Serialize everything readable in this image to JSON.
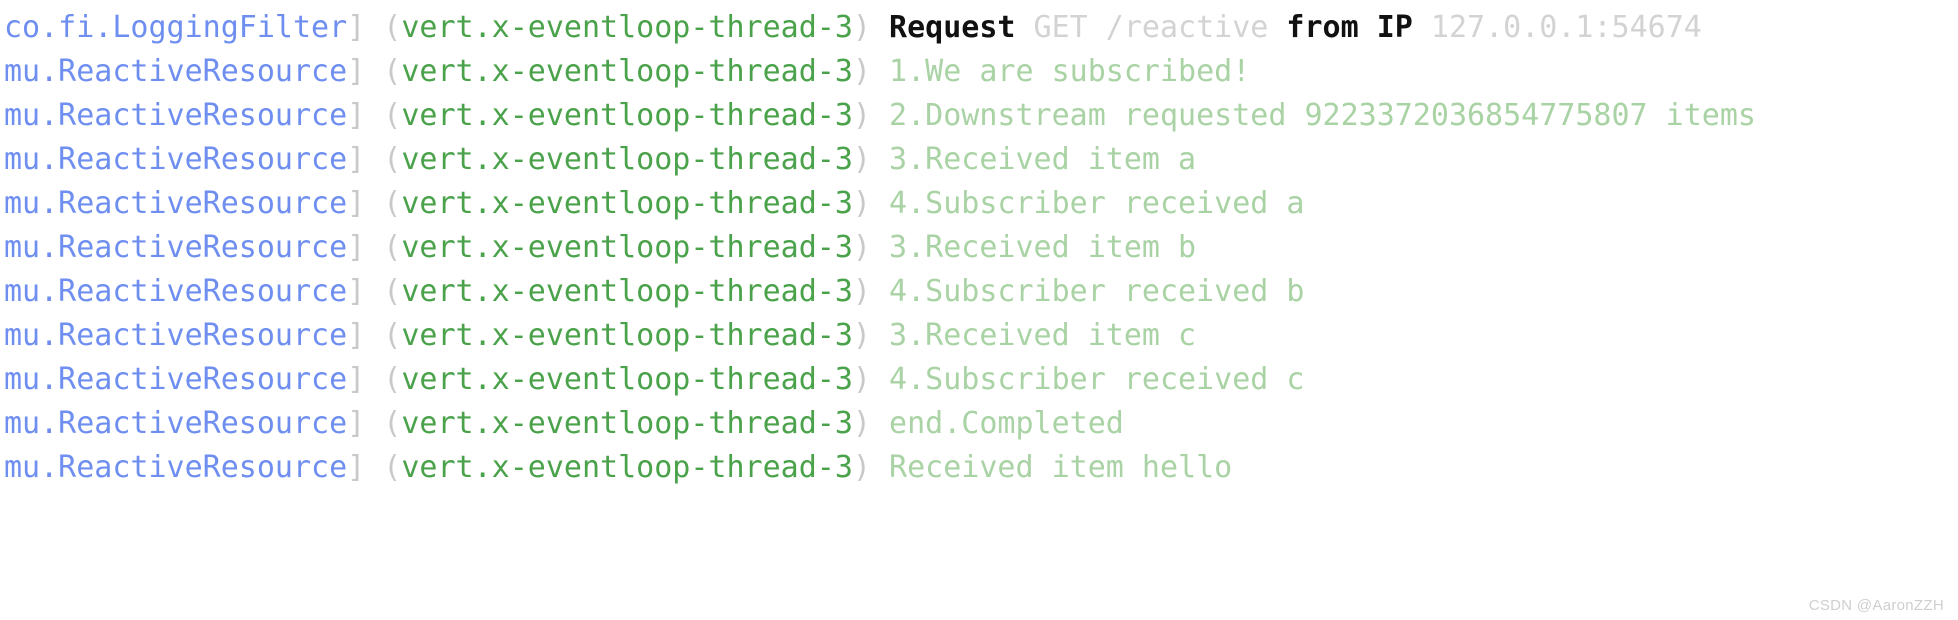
{
  "console": {
    "background_color": "#ffffff",
    "colors": {
      "logger": "#6f8ff0",
      "bracket": "#c9c9c9",
      "thread": "#4aa24a",
      "message": "#a9d3a4",
      "strong": "#111111",
      "dim": "#d3d3d3",
      "watermark": "#cfcfcf"
    },
    "lines": [
      {
        "logger": "co.fi.LoggingFilter",
        "bracket_close": "]",
        "thread": "(vert.x-eventloop-thread-3)",
        "segments": [
          {
            "text": "Request",
            "style": "strong"
          },
          {
            "text": " ",
            "style": "msg"
          },
          {
            "text": "GET /reactive",
            "style": "dim"
          },
          {
            "text": " ",
            "style": "msg"
          },
          {
            "text": "from IP",
            "style": "strong"
          },
          {
            "text": " ",
            "style": "msg"
          },
          {
            "text": "127.0.0.1:54674",
            "style": "dim"
          }
        ]
      },
      {
        "logger": "mu.ReactiveResource",
        "bracket_close": "]",
        "thread": "(vert.x-eventloop-thread-3)",
        "segments": [
          {
            "text": "1.We are subscribed!",
            "style": "msg"
          }
        ]
      },
      {
        "logger": "mu.ReactiveResource",
        "bracket_close": "]",
        "thread": "(vert.x-eventloop-thread-3)",
        "segments": [
          {
            "text": "2.Downstream requested 9223372036854775807 items",
            "style": "msg"
          }
        ]
      },
      {
        "logger": "mu.ReactiveResource",
        "bracket_close": "]",
        "thread": "(vert.x-eventloop-thread-3)",
        "segments": [
          {
            "text": "3.Received item a",
            "style": "msg"
          }
        ]
      },
      {
        "logger": "mu.ReactiveResource",
        "bracket_close": "]",
        "thread": "(vert.x-eventloop-thread-3)",
        "segments": [
          {
            "text": "4.Subscriber received a",
            "style": "msg"
          }
        ]
      },
      {
        "logger": "mu.ReactiveResource",
        "bracket_close": "]",
        "thread": "(vert.x-eventloop-thread-3)",
        "segments": [
          {
            "text": "3.Received item b",
            "style": "msg"
          }
        ]
      },
      {
        "logger": "mu.ReactiveResource",
        "bracket_close": "]",
        "thread": "(vert.x-eventloop-thread-3)",
        "segments": [
          {
            "text": "4.Subscriber received b",
            "style": "msg"
          }
        ]
      },
      {
        "logger": "mu.ReactiveResource",
        "bracket_close": "]",
        "thread": "(vert.x-eventloop-thread-3)",
        "segments": [
          {
            "text": "3.Received item c",
            "style": "msg"
          }
        ]
      },
      {
        "logger": "mu.ReactiveResource",
        "bracket_close": "]",
        "thread": "(vert.x-eventloop-thread-3)",
        "segments": [
          {
            "text": "4.Subscriber received c",
            "style": "msg"
          }
        ]
      },
      {
        "logger": "mu.ReactiveResource",
        "bracket_close": "]",
        "thread": "(vert.x-eventloop-thread-3)",
        "segments": [
          {
            "text": "end.Completed",
            "style": "msg"
          }
        ]
      },
      {
        "logger": "mu.ReactiveResource",
        "bracket_close": "]",
        "thread": "(vert.x-eventloop-thread-3)",
        "segments": [
          {
            "text": "Received item hello",
            "style": "msg"
          }
        ]
      }
    ]
  },
  "watermark": {
    "text": "CSDN @AaronZZH"
  }
}
